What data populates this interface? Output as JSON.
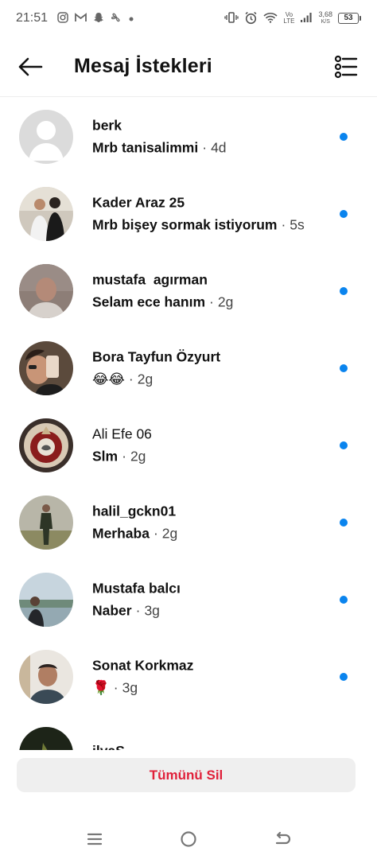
{
  "status_bar": {
    "time": "21:51",
    "left_icons": [
      "instagram-icon",
      "gmail-icon",
      "snapchat-icon",
      "fan-icon",
      "dot-icon"
    ],
    "lte_top": "Vo",
    "lte_bottom": "LTE",
    "net_speed_value": "3,68",
    "net_speed_unit": "K/S",
    "battery": "53"
  },
  "header": {
    "title": "Mesaj İstekleri"
  },
  "requests": [
    {
      "name": "berk",
      "message": "Mrb tanisalimmi",
      "time": "4d",
      "name_bold": true
    },
    {
      "name": "Kader Araz 25",
      "message": "Mrb bişey sormak istiyorum",
      "time": "5s",
      "name_bold": true
    },
    {
      "name": "mustafa  agırman",
      "message": "Selam ece hanım",
      "time": "2g",
      "name_bold": true
    },
    {
      "name": "Bora Tayfun Özyurt",
      "message": "😂😂",
      "time": "2g",
      "name_bold": true
    },
    {
      "name": "Ali Efe 06",
      "message": "Slm",
      "time": "2g",
      "name_bold": true
    },
    {
      "name": "halil_gckn01",
      "message": "Merhaba",
      "time": "2g",
      "name_bold": true
    },
    {
      "name": "Mustafa balcı",
      "message": "Naber",
      "time": "3g",
      "name_bold": true
    },
    {
      "name": "Sonat Korkmaz",
      "message": "🌹",
      "time": "3g",
      "name_bold": true
    },
    {
      "name": "ilyaS",
      "message": "",
      "time": "",
      "name_bold": true
    }
  ],
  "separator": "·",
  "delete_all_label": "Tümünü Sil",
  "colors": {
    "accent_blue": "#0a84ee",
    "delete_red": "#e0203a"
  }
}
